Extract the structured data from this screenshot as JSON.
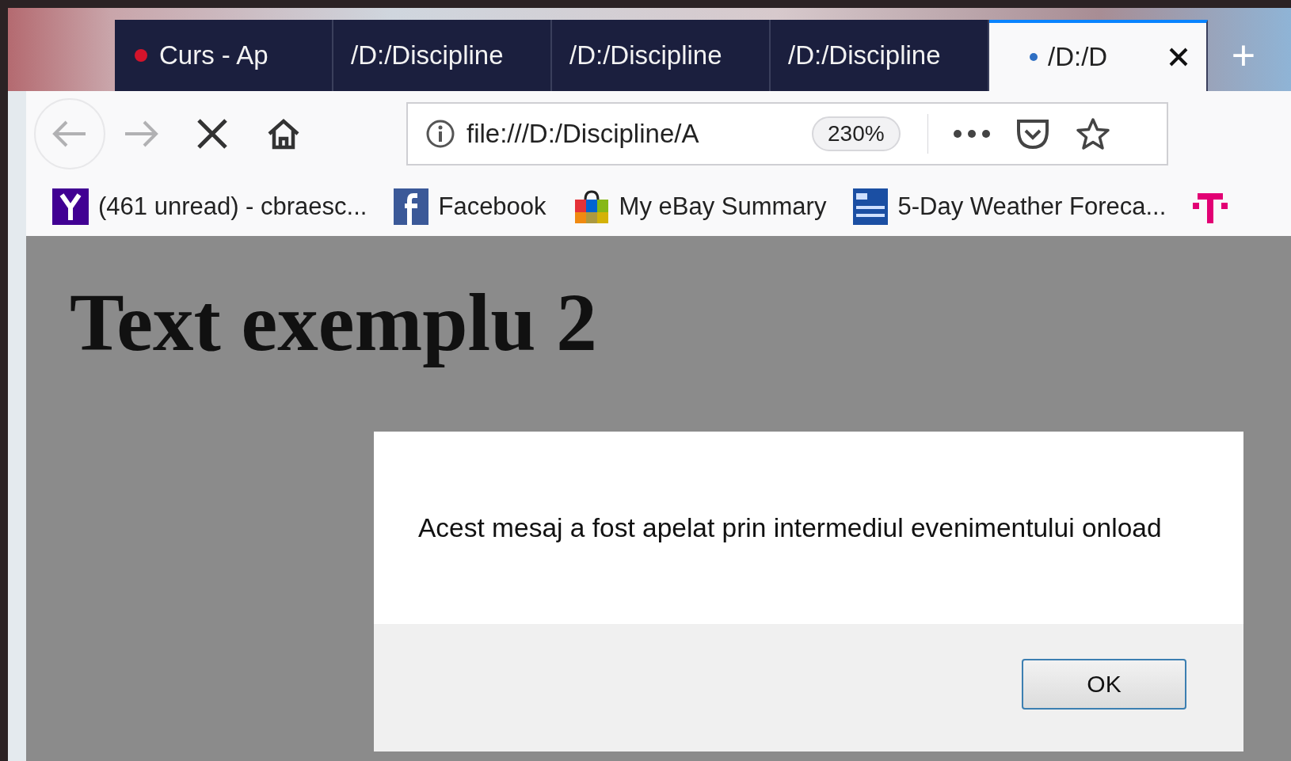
{
  "tabs": [
    {
      "label": "Curs - Ap",
      "selected": false,
      "kind": "red-icon"
    },
    {
      "label": "/D:/Discipline",
      "selected": false,
      "kind": "plain"
    },
    {
      "label": "/D:/Discipline",
      "selected": false,
      "kind": "plain"
    },
    {
      "label": "/D:/Discipline",
      "selected": false,
      "kind": "plain"
    },
    {
      "label": "/D:/D",
      "selected": true,
      "kind": "loading"
    }
  ],
  "new_tab": "+",
  "address_bar": {
    "url": "file:///D:/Discipline/A",
    "zoom": "230%"
  },
  "bookmarks": [
    {
      "label": "(461 unread) - cbraesc...",
      "kind": "yahoo"
    },
    {
      "label": "Facebook",
      "kind": "facebook"
    },
    {
      "label": "My eBay Summary",
      "kind": "bag"
    },
    {
      "label": "5-Day Weather Foreca...",
      "kind": "weather"
    },
    {
      "kind": "tmobile"
    }
  ],
  "page": {
    "heading": "Text exemplu 2"
  },
  "dialog": {
    "message": "Acest mesaj a fost apelat prin intermediul evenimentului onload",
    "button": "OK"
  }
}
